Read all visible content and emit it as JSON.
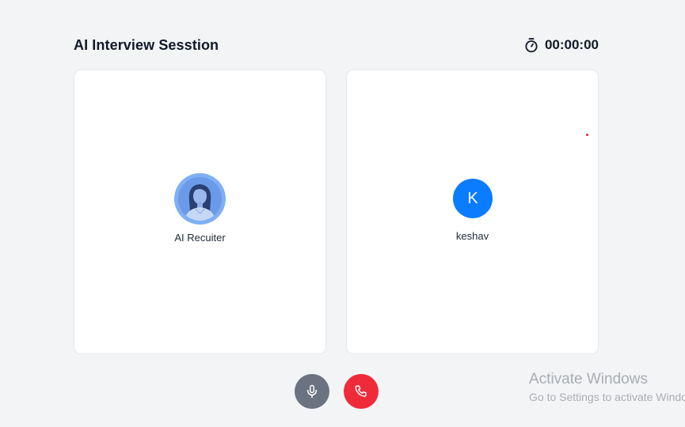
{
  "header": {
    "title": "AI Interview Sesstion",
    "timer_icon": "stopwatch-icon",
    "timer": "00:00:00"
  },
  "ai_card": {
    "avatar_icon": "recruiter-avatar",
    "name": "AI Recuiter"
  },
  "user_card": {
    "initial": "K",
    "name": "keshav"
  },
  "controls": {
    "mic_icon": "microphone-icon",
    "end_icon": "phone-hangup-icon"
  },
  "colors": {
    "background": "#f3f4f6",
    "user_avatar": "#0a7cff",
    "mic_button": "#6b7280",
    "end_button": "#ef2b3a"
  },
  "os_watermark": {
    "line1": "Activate Windows",
    "line2": "Go to Settings to activate Windows."
  }
}
